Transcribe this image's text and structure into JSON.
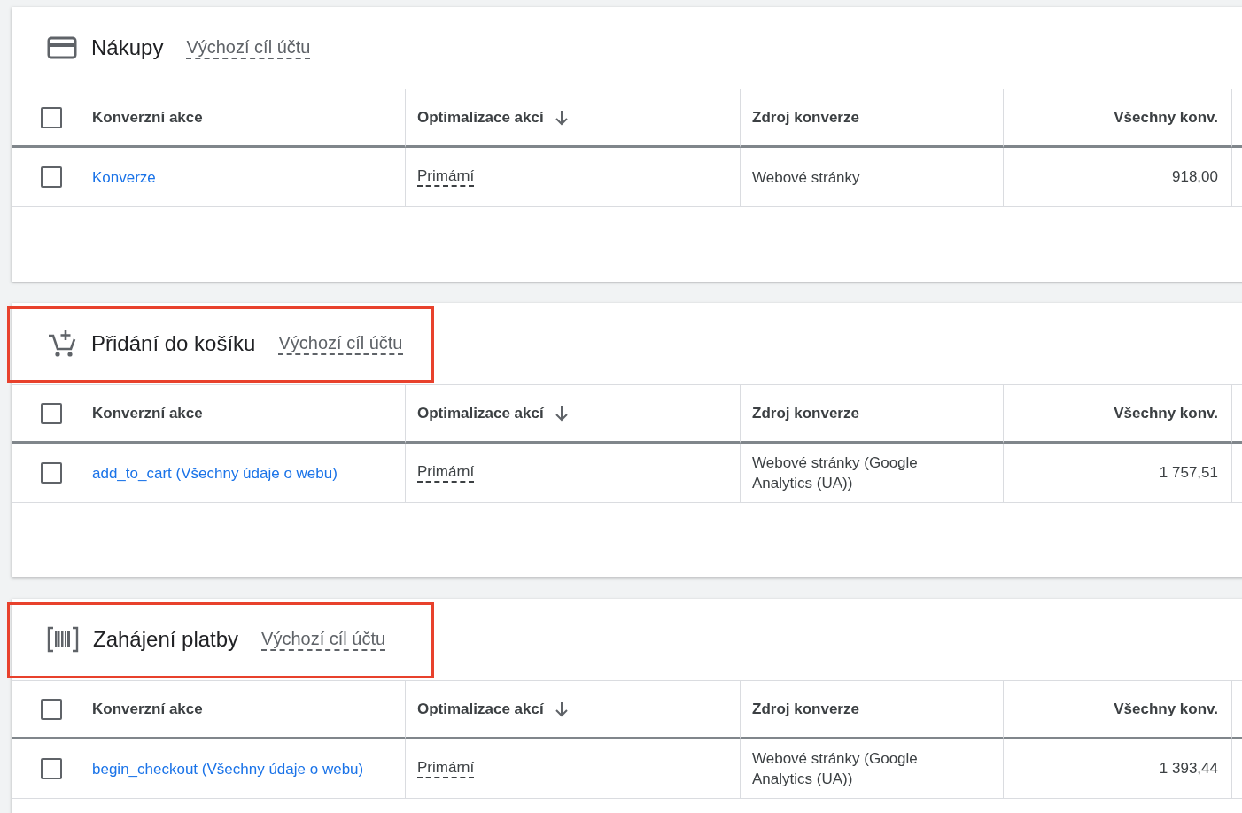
{
  "sections": [
    {
      "kind": "card",
      "title": "Nákupy",
      "subtitle": "Výchozí cíl účtu",
      "highlighted": false,
      "header_checked": false,
      "columns": [
        {
          "label": "Konverzní akce",
          "sorted": false
        },
        {
          "label": "Optimalizace akcí",
          "sorted": true
        },
        {
          "label": "Zdroj konverze",
          "sorted": false
        },
        {
          "label": "Všechny konv.",
          "sorted": false
        }
      ],
      "rows": [
        {
          "checked": false,
          "name": "Konverze",
          "optimization": "Primární",
          "source": "Webové stránky",
          "all_conversions": "918,00"
        }
      ]
    },
    {
      "kind": "cart",
      "title": "Přidání do košíku",
      "subtitle": "Výchozí cíl účtu",
      "highlighted": true,
      "header_checked": false,
      "columns": [
        {
          "label": "Konverzní akce",
          "sorted": false
        },
        {
          "label": "Optimalizace akcí",
          "sorted": true
        },
        {
          "label": "Zdroj konverze",
          "sorted": false
        },
        {
          "label": "Všechny konv.",
          "sorted": false
        }
      ],
      "rows": [
        {
          "checked": false,
          "name": "add_to_cart (Všechny údaje o webu)",
          "optimization": "Primární",
          "source": "Webové stránky (Google Analytics (UA))",
          "all_conversions": "1 757,51"
        }
      ]
    },
    {
      "kind": "barcode",
      "title": "Zahájení platby",
      "subtitle": "Výchozí cíl účtu",
      "highlighted": true,
      "header_checked": false,
      "columns": [
        {
          "label": "Konverzní akce",
          "sorted": false
        },
        {
          "label": "Optimalizace akcí",
          "sorted": true
        },
        {
          "label": "Zdroj konverze",
          "sorted": false
        },
        {
          "label": "Všechny konv.",
          "sorted": false
        }
      ],
      "rows": [
        {
          "checked": false,
          "name": "begin_checkout (Všechny údaje o webu)",
          "optimization": "Primární",
          "source": "Webové stránky (Google Analytics (UA))",
          "all_conversions": "1 393,44"
        }
      ]
    }
  ]
}
